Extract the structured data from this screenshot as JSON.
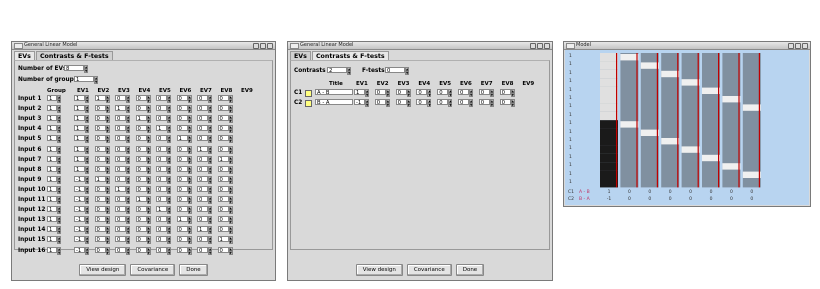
{
  "win1": {
    "title": "General Linear Model",
    "tabs": [
      "EVs",
      "Contrasts & F-tests"
    ],
    "num_evs_label": "Number of EVs",
    "num_evs": "8",
    "num_groups_label": "Number of groups",
    "num_groups": "1",
    "col_group": "Group",
    "ev_headers": [
      "EV1",
      "EV2",
      "EV3",
      "EV4",
      "EV5",
      "EV6",
      "EV7",
      "EV8",
      "EV9"
    ],
    "rows": [
      {
        "label": "Input 1",
        "group": "1",
        "evs": [
          "1",
          "1",
          "0",
          "0",
          "0",
          "0",
          "0",
          "0"
        ]
      },
      {
        "label": "Input 2",
        "group": "1",
        "evs": [
          "1",
          "0",
          "1",
          "0",
          "0",
          "0",
          "0",
          "0"
        ]
      },
      {
        "label": "Input 3",
        "group": "1",
        "evs": [
          "1",
          "0",
          "0",
          "1",
          "0",
          "0",
          "0",
          "0"
        ]
      },
      {
        "label": "Input 4",
        "group": "1",
        "evs": [
          "1",
          "0",
          "0",
          "0",
          "1",
          "0",
          "0",
          "0"
        ]
      },
      {
        "label": "Input 5",
        "group": "1",
        "evs": [
          "1",
          "0",
          "0",
          "0",
          "0",
          "1",
          "0",
          "0"
        ]
      },
      {
        "label": "Input 6",
        "group": "1",
        "evs": [
          "1",
          "0",
          "0",
          "0",
          "0",
          "0",
          "1",
          "0"
        ]
      },
      {
        "label": "Input 7",
        "group": "1",
        "evs": [
          "1",
          "0",
          "0",
          "0",
          "0",
          "0",
          "0",
          "1"
        ]
      },
      {
        "label": "Input 8",
        "group": "1",
        "evs": [
          "1",
          "0",
          "0",
          "0",
          "0",
          "0",
          "0",
          "0"
        ]
      },
      {
        "label": "Input 9",
        "group": "1",
        "evs": [
          "-1",
          "1",
          "0",
          "0",
          "0",
          "0",
          "0",
          "0"
        ]
      },
      {
        "label": "Input 10",
        "group": "1",
        "evs": [
          "-1",
          "0",
          "1",
          "0",
          "0",
          "0",
          "0",
          "0"
        ]
      },
      {
        "label": "Input 11",
        "group": "1",
        "evs": [
          "-1",
          "0",
          "0",
          "1",
          "0",
          "0",
          "0",
          "0"
        ]
      },
      {
        "label": "Input 12",
        "group": "1",
        "evs": [
          "-1",
          "0",
          "0",
          "0",
          "1",
          "0",
          "0",
          "0"
        ]
      },
      {
        "label": "Input 13",
        "group": "1",
        "evs": [
          "-1",
          "0",
          "0",
          "0",
          "0",
          "1",
          "0",
          "0"
        ]
      },
      {
        "label": "Input 14",
        "group": "1",
        "evs": [
          "-1",
          "0",
          "0",
          "0",
          "0",
          "0",
          "1",
          "0"
        ]
      },
      {
        "label": "Input 15",
        "group": "1",
        "evs": [
          "-1",
          "0",
          "0",
          "0",
          "0",
          "0",
          "0",
          "1"
        ]
      },
      {
        "label": "Input 16",
        "group": "1",
        "evs": [
          "-1",
          "0",
          "0",
          "0",
          "0",
          "0",
          "0",
          "0"
        ]
      }
    ],
    "buttons": [
      "View design",
      "Covariance",
      "Done"
    ]
  },
  "win2": {
    "title": "General Linear Model",
    "tabs": [
      "EVs",
      "Contrasts & F-tests"
    ],
    "contrasts_label": "Contrasts",
    "contrasts": "2",
    "ftests_label": "F-tests",
    "ftests": "0",
    "col_title": "Title",
    "ev_headers": [
      "EV1",
      "EV2",
      "EV3",
      "EV4",
      "EV5",
      "EV6",
      "EV7",
      "EV8",
      "EV9"
    ],
    "rows": [
      {
        "label": "C1",
        "title": "A - B",
        "evs": [
          "1",
          "0",
          "0",
          "0",
          "0",
          "0",
          "0",
          "0"
        ]
      },
      {
        "label": "C2",
        "title": "B - A",
        "evs": [
          "-1",
          "0",
          "0",
          "0",
          "0",
          "0",
          "0",
          "0"
        ]
      }
    ],
    "buttons": [
      "View design",
      "Covariance",
      "Done"
    ]
  },
  "win3": {
    "title": "Model",
    "row_labels": [
      "1",
      "1",
      "1",
      "1",
      "1",
      "1",
      "1",
      "1",
      "1",
      "1",
      "1",
      "1",
      "1",
      "1",
      "1",
      "1"
    ],
    "contrasts": [
      {
        "label": "C1",
        "title": "A - B",
        "values": [
          "1",
          "0",
          "0",
          "0",
          "0",
          "0",
          "0",
          "0"
        ]
      },
      {
        "label": "C2",
        "title": "B - A",
        "values": [
          "-1",
          "0",
          "0",
          "0",
          "0",
          "0",
          "0",
          "0"
        ]
      }
    ],
    "colors": {
      "bg": "#b8d4f0",
      "col": "#8090a0",
      "ev1_top": "#e0e0e0",
      "ev1_bottom": "#1a1a1a",
      "red": "#c00000"
    }
  }
}
